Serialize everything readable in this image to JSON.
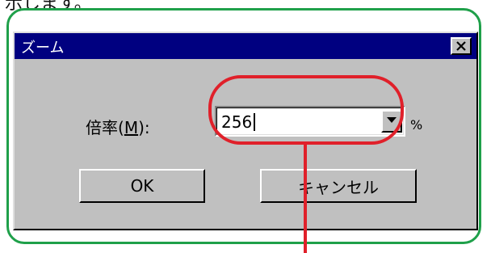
{
  "caption": {
    "text": "示します。"
  },
  "dialog": {
    "title": "ズーム",
    "close_icon": "close-x-icon",
    "magnification": {
      "label_prefix": "倍率(",
      "label_mnemonic": "M",
      "label_suffix": "):",
      "value": "256",
      "unit": "%",
      "dropdown_icon": "dropdown-arrow-icon"
    },
    "buttons": {
      "ok": "OK",
      "cancel": "キャンセル"
    }
  },
  "annotation": {
    "frame_color": "#1fa04a",
    "highlight_color": "#e0202a"
  },
  "colors": {
    "titlebar": "#000080",
    "dialog_face": "#c0c0c0"
  }
}
